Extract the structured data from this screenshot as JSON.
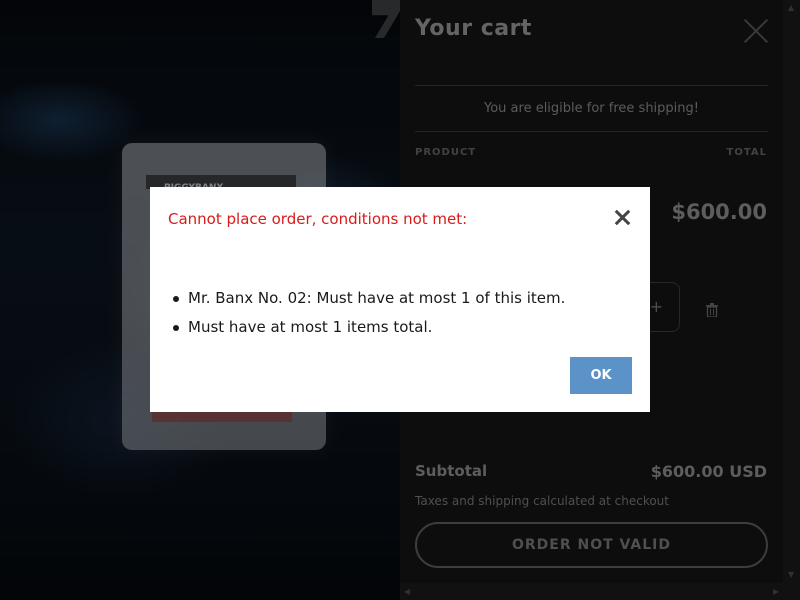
{
  "background": {
    "slab_label": "PIGGYBANX"
  },
  "cart": {
    "title": "Your cart",
    "free_shipping": "You are eligible for free shipping!",
    "col_product": "PRODUCT",
    "col_total": "TOTAL",
    "line_total": "$600.00",
    "qty_plus": "+",
    "subtotal_label": "Subtotal",
    "subtotal_value": "$600.00 USD",
    "tax_note": "Taxes and shipping calculated at checkout",
    "order_button": "ORDER NOT VALID",
    "close_icon": "close-icon",
    "delete_icon": "trash-icon"
  },
  "modal": {
    "title": "Cannot place order, conditions not met:",
    "errors": [
      "Mr. Banx No. 02: Must have at most 1 of this item.",
      "Must have at most 1 items total."
    ],
    "ok_label": "OK",
    "close_icon": "close-icon"
  },
  "colors": {
    "error_title": "#d81b1b",
    "ok_button": "#5b93c8",
    "cart_bg": "#141414"
  }
}
